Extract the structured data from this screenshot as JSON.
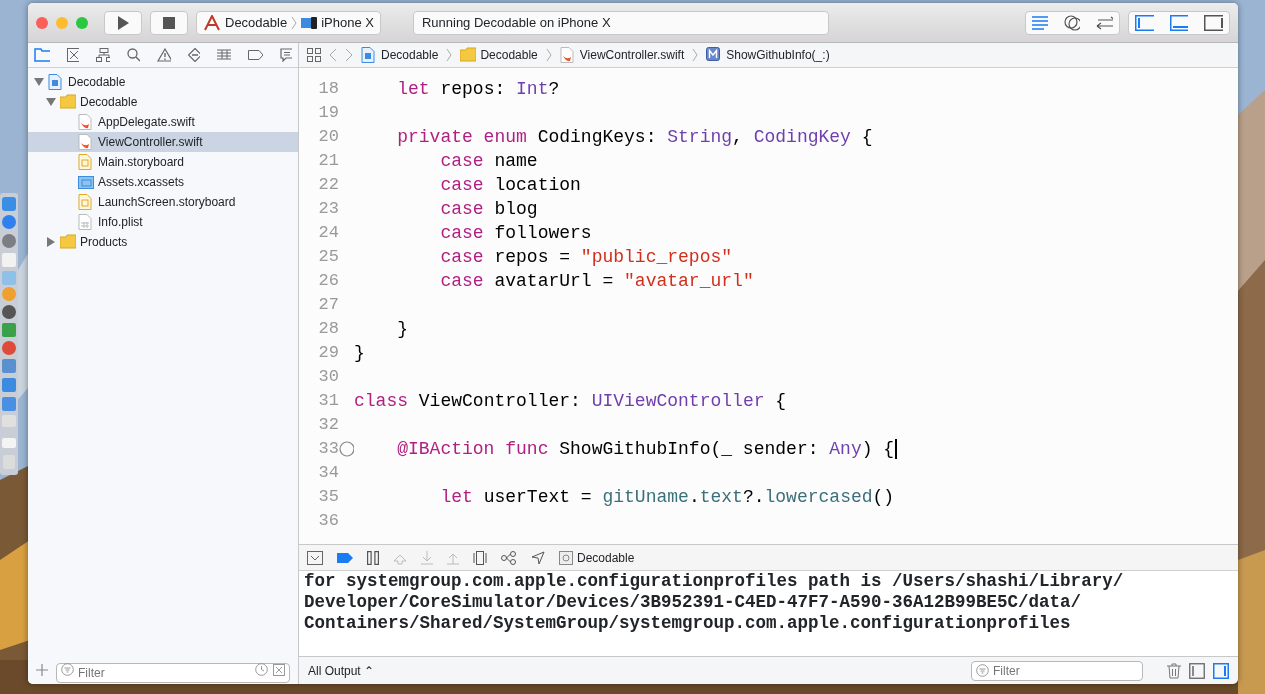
{
  "toolbar": {
    "scheme": "Decodable",
    "device": "iPhone X",
    "activity": "Running Decodable on iPhone X"
  },
  "jump_bar": [
    "Decodable",
    "Decodable",
    "ViewController.swift",
    "ShowGithubInfo(_:)"
  ],
  "navigator": {
    "tree": [
      {
        "label": "Decodable",
        "kind": "project",
        "expanded": true,
        "selected": false,
        "children": [
          {
            "label": "Decodable",
            "kind": "folder",
            "expanded": true,
            "selected": false,
            "children": [
              {
                "label": "AppDelegate.swift",
                "kind": "swift",
                "selected": false
              },
              {
                "label": "ViewController.swift",
                "kind": "swift",
                "selected": true
              },
              {
                "label": "Main.storyboard",
                "kind": "storyboard",
                "selected": false
              },
              {
                "label": "Assets.xcassets",
                "kind": "assets",
                "selected": false
              },
              {
                "label": "LaunchScreen.storyboard",
                "kind": "storyboard",
                "selected": false
              },
              {
                "label": "Info.plist",
                "kind": "plist",
                "selected": false
              }
            ]
          },
          {
            "label": "Products",
            "kind": "folder",
            "expanded": false,
            "selected": false
          }
        ]
      }
    ],
    "filter_placeholder": "Filter"
  },
  "editor": {
    "lines": [
      {
        "number": "18",
        "tokens": [
          {
            "kind": "keyword",
            "text": "    let"
          },
          {
            "kind": "plain",
            "text": " repos: "
          },
          {
            "kind": "type",
            "text": "Int"
          },
          {
            "kind": "plain",
            "text": "?"
          }
        ]
      },
      {
        "number": "19"
      },
      {
        "number": "20",
        "tokens": [
          {
            "kind": "keyword",
            "text": "    private enum"
          },
          {
            "kind": "plain",
            "text": " CodingKeys: "
          },
          {
            "kind": "type",
            "text": "String"
          },
          {
            "kind": "plain",
            "text": ", "
          },
          {
            "kind": "type",
            "text": "CodingKey"
          },
          {
            "kind": "plain",
            "text": " {"
          }
        ]
      },
      {
        "number": "21",
        "tokens": [
          {
            "kind": "keyword",
            "text": "        case"
          },
          {
            "kind": "plain",
            "text": " name"
          }
        ]
      },
      {
        "number": "22",
        "tokens": [
          {
            "kind": "keyword",
            "text": "        case"
          },
          {
            "kind": "plain",
            "text": " location"
          }
        ]
      },
      {
        "number": "23",
        "tokens": [
          {
            "kind": "keyword",
            "text": "        case"
          },
          {
            "kind": "plain",
            "text": " blog"
          }
        ]
      },
      {
        "number": "24",
        "tokens": [
          {
            "kind": "keyword",
            "text": "        case"
          },
          {
            "kind": "plain",
            "text": " followers"
          }
        ]
      },
      {
        "number": "25",
        "tokens": [
          {
            "kind": "keyword",
            "text": "        case"
          },
          {
            "kind": "plain",
            "text": " repos = "
          },
          {
            "kind": "string",
            "text": "\"public_repos\""
          }
        ]
      },
      {
        "number": "26",
        "tokens": [
          {
            "kind": "keyword",
            "text": "        case"
          },
          {
            "kind": "plain",
            "text": " avatarUrl = "
          },
          {
            "kind": "string",
            "text": "\"avatar_url\""
          }
        ]
      },
      {
        "number": "27"
      },
      {
        "number": "28",
        "tokens": [
          {
            "kind": "plain",
            "text": "    }"
          }
        ]
      },
      {
        "number": "29",
        "tokens": [
          {
            "kind": "plain",
            "text": "}"
          }
        ]
      },
      {
        "number": "30"
      },
      {
        "number": "31",
        "tokens": [
          {
            "kind": "keyword",
            "text": "class"
          },
          {
            "kind": "plain",
            "text": " ViewController: "
          },
          {
            "kind": "type",
            "text": "UIViewController"
          },
          {
            "kind": "plain",
            "text": " {"
          }
        ]
      },
      {
        "number": "32"
      },
      {
        "number": "33",
        "breakpoint": true,
        "cursor": true,
        "tokens": [
          {
            "kind": "keyword",
            "text": "    @IBAction func"
          },
          {
            "kind": "plain",
            "text": " ShowGithubInfo(_ sender: "
          },
          {
            "kind": "type",
            "text": "Any"
          },
          {
            "kind": "plain",
            "text": ") {"
          }
        ]
      },
      {
        "number": "34"
      },
      {
        "number": "35",
        "tokens": [
          {
            "kind": "keyword",
            "text": "        let"
          },
          {
            "kind": "plain",
            "text": " userText = "
          },
          {
            "kind": "member",
            "text": "gitUname"
          },
          {
            "kind": "plain",
            "text": "."
          },
          {
            "kind": "member",
            "text": "text"
          },
          {
            "kind": "plain",
            "text": "?."
          },
          {
            "kind": "member",
            "text": "lowercased"
          },
          {
            "kind": "plain",
            "text": "()"
          }
        ]
      },
      {
        "number": "36"
      }
    ]
  },
  "debug_bar": {
    "target": "Decodable"
  },
  "console": {
    "lines": [
      "for systemgroup.com.apple.configurationprofiles path is /Users/shashi/Library/",
      "Developer/CoreSimulator/Devices/3B952391-C4ED-47F7-A590-36A12B99BE5C/data/",
      "Containers/Shared/SystemGroup/systemgroup.com.apple.configurationprofiles"
    ],
    "output_menu": "All Output ⌃",
    "filter_placeholder": "Filter"
  }
}
